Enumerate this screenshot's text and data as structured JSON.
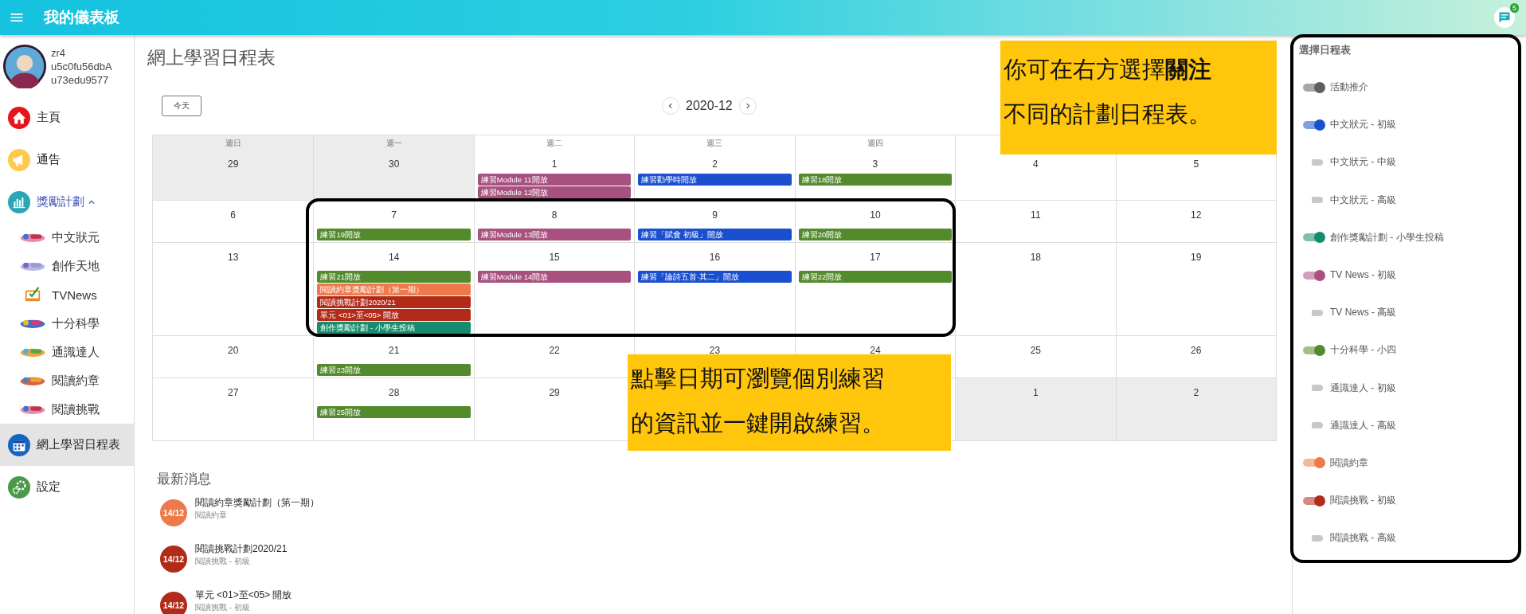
{
  "topbar": {
    "title": "我的儀表板",
    "notifications": "5"
  },
  "user": {
    "lines": [
      "zr4",
      "u5c0fu56dbA",
      "u73edu9577"
    ]
  },
  "nav": [
    {
      "kind": "home",
      "label": "主頁",
      "selected": false
    },
    {
      "kind": "notice",
      "label": "通告",
      "selected": false
    },
    {
      "kind": "rewards",
      "label": "獎勵計劃",
      "selected": false,
      "expanded": true,
      "children": [
        {
          "kind": "logo",
          "label": "中文狀元"
        },
        {
          "kind": "logo",
          "label": "創作天地"
        },
        {
          "kind": "tv",
          "label": "TVNews"
        },
        {
          "kind": "logo",
          "label": "十分科學"
        },
        {
          "kind": "logo",
          "label": "通識達人"
        },
        {
          "kind": "logo",
          "label": "閱讀約章"
        },
        {
          "kind": "logo",
          "label": "閱讀挑戰"
        }
      ]
    },
    {
      "kind": "calendar",
      "label": "網上學習日程表",
      "selected": true
    },
    {
      "kind": "settings",
      "label": "設定",
      "selected": false
    }
  ],
  "page_title": "網上學習日程表",
  "calendar": {
    "today_button": "今天",
    "month": "2020-12",
    "weekdays": [
      "週日",
      "週一",
      "週二",
      "週三",
      "週四"
    ],
    "weeks": [
      [
        {
          "day": "29",
          "outside": true
        },
        {
          "day": "30",
          "outside": true
        },
        {
          "day": "1",
          "outside": false,
          "events": [
            {
              "title": "練習Module 11開放",
              "color": "#a8517f"
            },
            {
              "title": "練習Module 12開放",
              "color": "#a8517f"
            }
          ]
        },
        {
          "day": "2",
          "outside": false,
          "events": [
            {
              "title": "練習勸學時開放",
              "color": "#1a4fd0"
            }
          ]
        },
        {
          "day": "3",
          "outside": false,
          "events": [
            {
              "title": "練習18開放",
              "color": "#538a2c"
            }
          ]
        },
        {
          "day": "4",
          "outside": false
        },
        {
          "day": "5",
          "outside": false
        }
      ],
      [
        {
          "day": "6",
          "outside": false
        },
        {
          "day": "7",
          "outside": false,
          "events": [
            {
              "title": "練習19開放",
              "color": "#538a2c"
            }
          ]
        },
        {
          "day": "8",
          "outside": false,
          "events": [
            {
              "title": "練習Module 13開放",
              "color": "#a8517f"
            }
          ]
        },
        {
          "day": "9",
          "outside": false,
          "events": [
            {
              "title": "練習「賦會 初級」開放",
              "color": "#1a4fd0"
            }
          ]
        },
        {
          "day": "10",
          "outside": false,
          "events": [
            {
              "title": "練習20開放",
              "color": "#538a2c"
            }
          ]
        },
        {
          "day": "11",
          "outside": false
        },
        {
          "day": "12",
          "outside": false
        }
      ],
      [
        {
          "day": "13",
          "outside": false
        },
        {
          "day": "14",
          "outside": false,
          "events": [
            {
              "title": "練習21開放",
              "color": "#538a2c"
            },
            {
              "title": "閱讀約章獎勵計劃（第一期）",
              "color": "#ee7a4b"
            },
            {
              "title": "閱讀挑戰計劃2020/21",
              "color": "#b22a18"
            },
            {
              "title": "單元 <01>至<05> 開放",
              "color": "#b22a18"
            },
            {
              "title": "創作獎勵計劃 - 小學生投稿",
              "color": "#168c6e"
            }
          ]
        },
        {
          "day": "15",
          "outside": false,
          "events": [
            {
              "title": "練習Module 14開放",
              "color": "#a8517f"
            }
          ]
        },
        {
          "day": "16",
          "outside": false,
          "events": [
            {
              "title": "練習「論詩五首·其二」開放",
              "color": "#1a4fd0"
            }
          ]
        },
        {
          "day": "17",
          "outside": false,
          "events": [
            {
              "title": "練習22開放",
              "color": "#538a2c"
            }
          ]
        },
        {
          "day": "18",
          "outside": false
        },
        {
          "day": "19",
          "outside": false
        }
      ],
      [
        {
          "day": "20",
          "outside": false
        },
        {
          "day": "21",
          "outside": false,
          "events": [
            {
              "title": "練習23開放",
              "color": "#538a2c"
            }
          ]
        },
        {
          "day": "22",
          "outside": false
        },
        {
          "day": "23",
          "outside": false
        },
        {
          "day": "24",
          "outside": false
        },
        {
          "day": "25",
          "outside": false
        },
        {
          "day": "26",
          "outside": false
        }
      ],
      [
        {
          "day": "27",
          "outside": false
        },
        {
          "day": "28",
          "outside": false,
          "events": [
            {
              "title": "練習25開放",
              "color": "#538a2c"
            }
          ]
        },
        {
          "day": "29",
          "outside": false
        },
        {
          "day": "1",
          "outside": true,
          "after_gap": true
        },
        {
          "day": "2",
          "outside": true
        }
      ]
    ]
  },
  "news": {
    "title": "最新消息",
    "items": [
      {
        "date": "14/12",
        "title": "閱讀約章獎勵計劃（第一期）",
        "subtitle": "閱讀約章",
        "color": "#ee7a4b"
      },
      {
        "date": "14/12",
        "title": "閱讀挑戰計劃2020/21",
        "subtitle": "閱讀挑戰 - 初級",
        "color": "#b22a18"
      },
      {
        "date": "14/12",
        "title": "單元 <01>至<05> 開放",
        "subtitle": "閱讀挑戰 - 初級",
        "color": "#b22a18"
      }
    ]
  },
  "schedules": {
    "title": "選擇日程表",
    "items": [
      {
        "label": "活動推介",
        "on": true,
        "color": "#5f5f5f"
      },
      {
        "label": "中文狀元 - 初級",
        "on": true,
        "color": "#1a4fd0"
      },
      {
        "label": "中文狀元 - 中級",
        "on": false
      },
      {
        "label": "中文狀元 - 高級",
        "on": false
      },
      {
        "label": "創作獎勵計劃 - 小學生投稿",
        "on": true,
        "color": "#168c6e"
      },
      {
        "label": "TV News - 初級",
        "on": true,
        "color": "#a8517f"
      },
      {
        "label": "TV News - 高級",
        "on": false
      },
      {
        "label": "十分科學 - 小四",
        "on": true,
        "color": "#538a2c"
      },
      {
        "label": "通識達人 - 初級",
        "on": false
      },
      {
        "label": "通識達人 - 高級",
        "on": false
      },
      {
        "label": "閱讀約章",
        "on": true,
        "color": "#ee7a4b"
      },
      {
        "label": "閱讀挑戰 - 初級",
        "on": true,
        "color": "#b22a18"
      },
      {
        "label": "閱讀挑戰 - 高級",
        "on": false
      }
    ]
  },
  "callouts": [
    {
      "text": [
        "你可在右方選擇**關注**",
        "不同的計劃日程表。"
      ]
    },
    {
      "text": [
        "點擊日期可瀏覽個別練習",
        "的資訊並一鍵開啟練習。"
      ]
    }
  ]
}
